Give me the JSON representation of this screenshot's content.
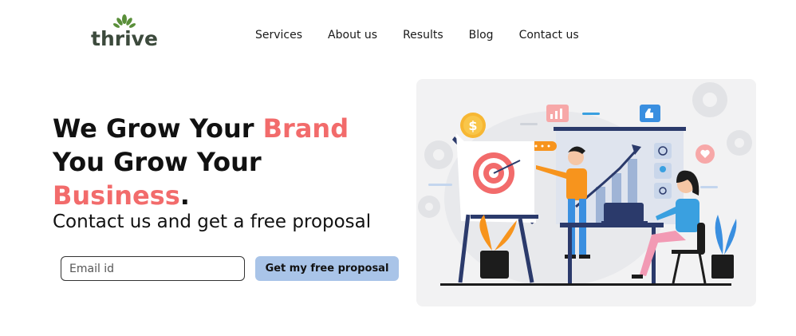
{
  "brand": {
    "logo_text": "thrive"
  },
  "nav": {
    "items": [
      "Services",
      "About us",
      "Results",
      "Blog",
      "Contact us"
    ]
  },
  "hero": {
    "line1_a": "We Grow Your ",
    "line1_b": "Brand",
    "line2": "You Grow Your",
    "line3_a": "Business",
    "line3_b": ".",
    "subtitle": "Contact us and get a free proposal"
  },
  "form": {
    "email_placeholder": "Email id",
    "email_value": "",
    "cta_label": "Get my free proposal"
  },
  "illustration": {
    "dollar_symbol": "$",
    "colors": {
      "accent": "#f26b6b",
      "navy": "#2b3a6b",
      "orange": "#f7941d",
      "blue": "#3aa0e0",
      "cta_bg": "#a9c4e8"
    }
  }
}
